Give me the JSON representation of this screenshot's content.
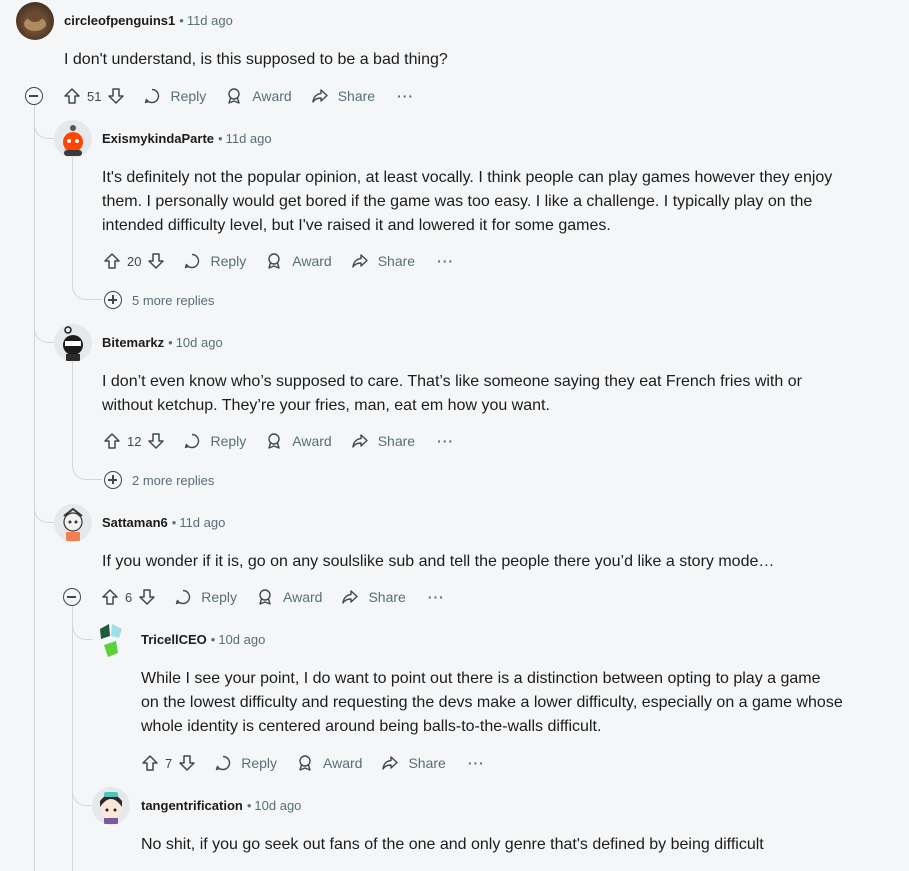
{
  "comments": [
    {
      "id": "c1",
      "username": "circleofpenguins1",
      "age": "11d ago",
      "body": "I don't understand, is this supposed to be a bad thing?",
      "votes": "51",
      "actions": {
        "reply": "Reply",
        "award": "Award",
        "share": "Share"
      }
    },
    {
      "id": "c2",
      "username": "ExismykindaParte",
      "age": "11d ago",
      "body_lines": [
        "It's definitely not the popular opinion, at least vocally. I think people can play games however they enjoy",
        "them. I personally would get bored if the game was too easy. I like a challenge. I typically play on the",
        "intended difficulty level, but I've raised it and lowered it for some games."
      ],
      "votes": "20",
      "actions": {
        "reply": "Reply",
        "award": "Award",
        "share": "Share"
      },
      "more_replies": "5 more replies"
    },
    {
      "id": "c3",
      "username": "Bitemarkz",
      "age": "10d ago",
      "body_lines": [
        "I don’t even know who’s supposed to care. That’s like someone saying they eat French fries with or",
        "without ketchup. They’re your fries, man, eat em how you want."
      ],
      "votes": "12",
      "actions": {
        "reply": "Reply",
        "award": "Award",
        "share": "Share"
      },
      "more_replies": "2 more replies"
    },
    {
      "id": "c4",
      "username": "Sattaman6",
      "age": "11d ago",
      "body": "If you wonder if it is, go on any soulslike sub and tell the people there you’d like a story mode…",
      "votes": "6",
      "actions": {
        "reply": "Reply",
        "award": "Award",
        "share": "Share"
      }
    },
    {
      "id": "c5",
      "username": "TricellCEO",
      "age": "10d ago",
      "body_lines": [
        "While I see your point, I do want to point out there is a distinction between opting to play a game",
        "on the lowest difficulty and requesting the devs make a lower difficulty, especially on a game whose",
        "whole identity is centered around being balls-to-the-walls difficult."
      ],
      "votes": "7",
      "actions": {
        "reply": "Reply",
        "award": "Award",
        "share": "Share"
      }
    },
    {
      "id": "c6",
      "username": "tangentrification",
      "age": "10d ago",
      "body": "No shit, if you go seek out fans of the one and only genre that's defined by being difficult"
    }
  ],
  "separator": "•",
  "more_glyph": "···",
  "colors": {
    "background": "#f5f6f7",
    "meta": "#576f76",
    "thread_line": "#d2d6d9"
  }
}
